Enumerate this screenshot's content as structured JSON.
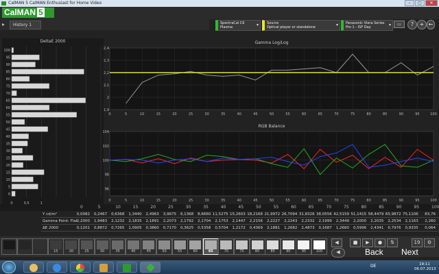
{
  "window": {
    "title": "CalMAN 5 CalMAN Enthusiast for Home Video",
    "controls": [
      "–",
      "▢",
      "✕"
    ]
  },
  "logo": {
    "text": "CalMAN",
    "version": "5"
  },
  "history": {
    "tab": "History 1"
  },
  "toolbar": {
    "dd1": {
      "line1": "SpectraCal C6",
      "line2": "Plasma"
    },
    "dd2": {
      "line1": "Source",
      "line2": "Optical player or standalone generator"
    },
    "dd3": {
      "line1": "Panasonic Viera Series",
      "line2": "Pro 1 - ISF Day"
    },
    "icons": [
      "?",
      "+",
      "←",
      "→"
    ]
  },
  "chart_data": [
    {
      "type": "bar",
      "title": "DeltaE 2000",
      "orientation": "horizontal",
      "categories": [
        "0",
        "5",
        "10",
        "15",
        "20",
        "25",
        "30",
        "35",
        "40",
        "45",
        "50",
        "55",
        "60",
        "65",
        "70",
        "75",
        "80",
        "85",
        "90",
        "95",
        "100"
      ],
      "values": [
        0.1201,
        0.8872,
        0.7265,
        1.0905,
        0.386,
        0.717,
        0.3625,
        0.5358,
        0.5704,
        1.2172,
        0.4369,
        2.1881,
        1.2682,
        2.4873,
        0.1687,
        1.266,
        0.5996,
        2.4341,
        0.7976,
        0.9335,
        0.064
      ],
      "y_tick_labels": [
        "100",
        "95",
        "90",
        "85",
        "80",
        "75",
        "70",
        "65",
        "60",
        "55",
        "50",
        "45",
        "40",
        "35",
        "30",
        "25",
        "20",
        "15",
        "10",
        "5",
        "0"
      ],
      "x_tick_labels": [
        "0",
        "0,5",
        "1"
      ]
    },
    {
      "type": "line",
      "title": "Gamma Log/Log",
      "x": [
        0,
        5,
        10,
        15,
        20,
        25,
        30,
        35,
        40,
        45,
        50,
        55,
        60,
        65,
        70,
        75,
        80,
        85,
        90,
        95,
        100
      ],
      "series": [
        {
          "values": [
            null,
            1.95,
            2.12,
            2.18,
            2.19,
            2.21,
            2.18,
            2.17,
            2.18,
            2.14,
            2.22,
            2.22,
            2.23,
            2.24,
            2.2,
            2.35,
            2.2,
            2.2,
            2.28,
            2.18,
            2.25
          ]
        },
        {
          "values": [
            2.2,
            2.2,
            2.2,
            2.2,
            2.2,
            2.2,
            2.2,
            2.2,
            2.2,
            2.2,
            2.2,
            2.2,
            2.2,
            2.2,
            2.2,
            2.2,
            2.2,
            2.2,
            2.2,
            2.2,
            2.2
          ]
        }
      ],
      "ylim": [
        1.9,
        2.4
      ],
      "y_ticks": [
        "2,4",
        "2,3",
        "2,2",
        "2,1",
        "2",
        "1,9"
      ],
      "x_ticks": [
        "0",
        "5",
        "10",
        "15",
        "20",
        "25",
        "30",
        "35",
        "40",
        "45",
        "50",
        "55",
        "60",
        "65",
        "70",
        "75",
        "80",
        "85",
        "90",
        "95",
        "100"
      ],
      "colors": {
        "measured": "#999999",
        "target": "#e6e619"
      }
    },
    {
      "type": "line",
      "title": "RGB Balance",
      "x": [
        0,
        5,
        10,
        15,
        20,
        25,
        30,
        35,
        40,
        45,
        50,
        55,
        60,
        65,
        70,
        75,
        80,
        85,
        90,
        95,
        100
      ],
      "series": [
        {
          "values": [
            100,
            100.1,
            99.6,
            100.2,
            99.5,
            100.3,
            99.8,
            100,
            100.1,
            100,
            99.6,
            100.8,
            98.8,
            101.5,
            99.7,
            100.7,
            98.8,
            100.4,
            99.0,
            101.5,
            100
          ]
        },
        {
          "values": [
            100,
            99.8,
            100.2,
            100.8,
            100.1,
            99.8,
            100.7,
            100.5,
            100.1,
            100.2,
            99.5,
            99.0,
            101.6,
            98.0,
            100.3,
            98.9,
            100.8,
            102.2,
            99.2,
            99.0,
            100
          ]
        },
        {
          "values": [
            100,
            100.1,
            100.0,
            99.6,
            100.0,
            100.2,
            99.8,
            100.3,
            100.1,
            100.2,
            100.4,
            99.8,
            99.3,
            100.5,
            101.0,
            102.2,
            99.0,
            99.3,
            99.8,
            100.3,
            99.8
          ]
        }
      ],
      "ylim": [
        95,
        104
      ],
      "y_ticks": [
        "104",
        "102",
        "100",
        "98",
        "96"
      ],
      "x_ticks": [
        "0",
        "5",
        "10",
        "15",
        "20",
        "25",
        "30",
        "35",
        "40",
        "45",
        "50",
        "55",
        "60",
        "65",
        "70",
        "75",
        "80",
        "85",
        "90",
        "95",
        "100"
      ],
      "colors": {
        "red": "#ff2222",
        "green": "#22aa22",
        "blue": "#2244ff"
      }
    }
  ],
  "table": {
    "x_labels": [
      "0",
      "5",
      "10",
      "15",
      "20",
      "25",
      "30",
      "35",
      "40",
      "45",
      "50",
      "55",
      "60",
      "65",
      "70",
      "75",
      "80",
      "85",
      "90",
      "95",
      "100"
    ],
    "rows": [
      {
        "label": "Y cd/m²",
        "cells": [
          "0,0082",
          "0,2467",
          "0,6368",
          "1,3440",
          "2,4963",
          "3,9675",
          "6,1368",
          "8,6660",
          "11,5275",
          "15,2603",
          "18,2168",
          "21,9972",
          "26,7094",
          "31,8326",
          "38,0556",
          "42,5159",
          "51,1415",
          "58,4479",
          "65,9872",
          "75,1106",
          "83,76"
        ]
      },
      {
        "label": "Gamma Point: Flat",
        "cells": [
          "2,2000",
          "1,9483",
          "2,1232",
          "2,1835",
          "2,1891",
          "2,2073",
          "2,1792",
          "2,1704",
          "2,1753",
          "2,1447",
          "2,2156",
          "2,2227",
          "2,2243",
          "2,2332",
          "2,1999",
          "2,3449",
          "2,2000",
          "2,2035",
          "2,2534",
          "2,1163",
          "2,260"
        ]
      },
      {
        "label": "ΔE 2000",
        "cells": [
          "0,1201",
          "0,8872",
          "0,7265",
          "1,0905",
          "0,3860",
          "0,7170",
          "0,3625",
          "0,5358",
          "0,5704",
          "1,2172",
          "0,4369",
          "2,1881",
          "1,2682",
          "2,4873",
          "0,1687",
          "1,2660",
          "0,5996",
          "2,4341",
          "0,7976",
          "0,9335",
          "0,064"
        ]
      }
    ]
  },
  "selector": {
    "swatches": [
      "0",
      "5",
      "10",
      "15",
      "20",
      "25",
      "30",
      "35",
      "40",
      "45",
      "50",
      "55",
      "60",
      "65",
      "70",
      "75",
      "80",
      "85",
      "90",
      "95",
      "100"
    ],
    "visible_labels": [
      "15",
      "20",
      "25",
      "30",
      "35",
      "40",
      "45",
      "50",
      "55",
      "60",
      "65",
      "70",
      "75",
      "80",
      "85",
      "90",
      "95",
      "100"
    ],
    "active": "65",
    "back": "Back",
    "next": "Next"
  },
  "taskbar": {
    "lang": "DE",
    "time": "19:11",
    "date": "06.07.2013"
  }
}
